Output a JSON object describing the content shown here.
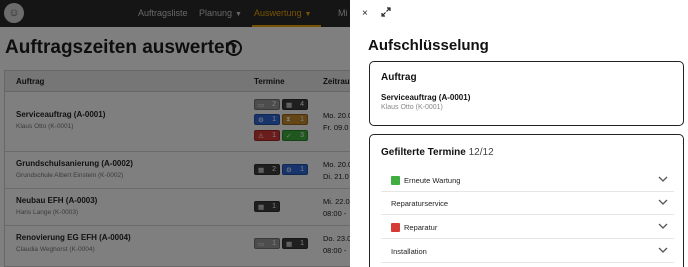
{
  "nav": {
    "items": [
      "Auftragsliste",
      "Planung",
      "Auswertung",
      "Mi"
    ],
    "active": "Auswertung"
  },
  "page": {
    "title": "Auftragszeiten auswerten",
    "help_icon": "?"
  },
  "table": {
    "headers": [
      "Auftrag",
      "Termine",
      "Zeitraum"
    ],
    "rows": [
      {
        "title": "Serviceauftrag (A-0001)",
        "customer": "Klaus Otto (K-0001)",
        "date1": "Mo. 20.0",
        "date2": "Fr. 09.0",
        "chips": [
          {
            "icon": "folder-icon",
            "color": "grey",
            "count": "2"
          },
          {
            "icon": "calendar-icon",
            "color": "dark",
            "count": "4"
          },
          {
            "icon": "gear-icon",
            "color": "blue",
            "count": "1"
          },
          {
            "icon": "hourglass-icon",
            "color": "orange",
            "count": "1"
          },
          {
            "icon": "warning-icon",
            "color": "red",
            "count": "1"
          },
          {
            "icon": "check-icon",
            "color": "green",
            "count": "3"
          }
        ]
      },
      {
        "title": "Grundschulsanierung (A-0002)",
        "customer": "Grundschule Albert Einstein (K-0002)",
        "date1": "Mo. 20.0",
        "date2": "Di. 21.0",
        "chips": [
          {
            "icon": "calendar-icon",
            "color": "dark",
            "count": "2"
          },
          {
            "icon": "gear-icon",
            "color": "blue",
            "count": "1"
          }
        ]
      },
      {
        "title": "Neubau EFH (A-0003)",
        "customer": "Hans Lange (K-0003)",
        "date1": "Mi. 22.0",
        "date2": "08:00 -",
        "chips": [
          {
            "icon": "calendar-icon",
            "color": "dark",
            "count": "1"
          }
        ]
      },
      {
        "title": "Renovierung EG EFH (A-0004)",
        "customer": "Claudia Weghorst (K-0004)",
        "date1": "Do. 23.0",
        "date2": "08:00 -",
        "chips": [
          {
            "icon": "folder-icon",
            "color": "grey",
            "count": "1"
          },
          {
            "icon": "calendar-icon",
            "color": "dark",
            "count": "1"
          }
        ]
      }
    ]
  },
  "drawer": {
    "close_icon": "×",
    "title": "Aufschlüsselung",
    "order_card": {
      "heading": "Auftrag",
      "name": "Serviceauftrag (A-0001)",
      "customer": "Klaus Otto (K-0001)"
    },
    "filter_card": {
      "heading": "Gefilterte Termine",
      "count": "12/12",
      "items": [
        {
          "label": "Erneute Wartung",
          "marker": "green"
        },
        {
          "label": "Reparaturservice",
          "marker": ""
        },
        {
          "label": "Reparatur",
          "marker": "red"
        },
        {
          "label": "Installation",
          "marker": ""
        }
      ]
    }
  }
}
